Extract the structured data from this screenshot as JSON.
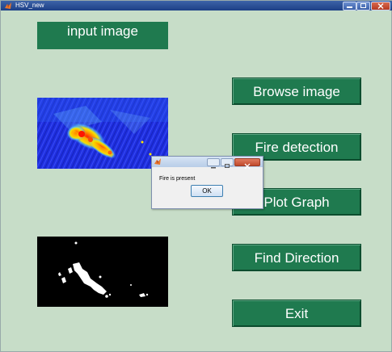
{
  "window": {
    "title": "HSV_new",
    "background_color": "#c7ddc8",
    "titlebar_icon": "matlab-icon",
    "controls": [
      "minimize-icon",
      "maximize-icon",
      "close-icon"
    ]
  },
  "panels": {
    "input_label": "input image",
    "input_image": "fire-heatmap-image",
    "output_image": "binary-fire-mask-image"
  },
  "buttons": {
    "browse_label": "Browse image",
    "detect_label": "Fire detection",
    "plot_label": "Plot Graph",
    "direction_label": "Find Direction",
    "exit_label": "Exit",
    "color": "#1f7a4f"
  },
  "dialog": {
    "title_icon": "matlab-icon",
    "message": "Fire is present",
    "ok_label": "OK"
  }
}
